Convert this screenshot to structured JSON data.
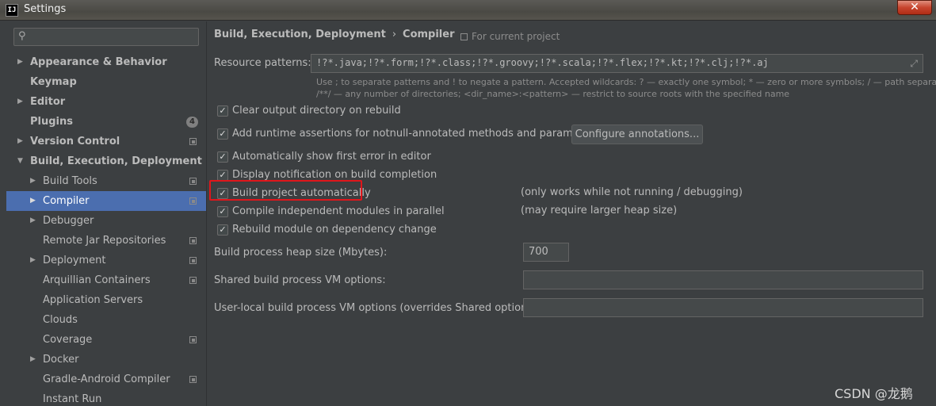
{
  "window": {
    "title": "Settings",
    "app_icon_text": "IJ",
    "close_symbol": "✕"
  },
  "sidebar": {
    "search_icon": "search-icon",
    "items": [
      {
        "label": "Appearance & Behavior",
        "arrow": "▶",
        "bold": true
      },
      {
        "label": "Keymap",
        "arrow": "",
        "bold": true
      },
      {
        "label": "Editor",
        "arrow": "▶",
        "bold": true
      },
      {
        "label": "Plugins",
        "arrow": "",
        "bold": true,
        "badge": "4"
      },
      {
        "label": "Version Control",
        "arrow": "▶",
        "bold": true
      },
      {
        "label": "Build, Execution, Deployment",
        "arrow": "▼",
        "bold": true
      },
      {
        "label": "Build Tools",
        "arrow": "▶",
        "bold": false
      },
      {
        "label": "Compiler",
        "arrow": "▶",
        "bold": false,
        "selected": true
      },
      {
        "label": "Debugger",
        "arrow": "▶",
        "bold": false
      },
      {
        "label": "Remote Jar Repositories",
        "arrow": "",
        "bold": false
      },
      {
        "label": "Deployment",
        "arrow": "▶",
        "bold": false
      },
      {
        "label": "Arquillian Containers",
        "arrow": "",
        "bold": false
      },
      {
        "label": "Application Servers",
        "arrow": "",
        "bold": false
      },
      {
        "label": "Clouds",
        "arrow": "",
        "bold": false
      },
      {
        "label": "Coverage",
        "arrow": "",
        "bold": false
      },
      {
        "label": "Docker",
        "arrow": "▶",
        "bold": false
      },
      {
        "label": "Gradle-Android Compiler",
        "arrow": "",
        "bold": false
      },
      {
        "label": "Instant Run",
        "arrow": "",
        "bold": false
      }
    ]
  },
  "breadcrumb": {
    "parent": "Build, Execution, Deployment",
    "separator": "›",
    "current": "Compiler"
  },
  "scope_label": "For current project",
  "resource_patterns": {
    "label": "Resource patterns:",
    "value": "!?*.java;!?*.form;!?*.class;!?*.groovy;!?*.scala;!?*.flex;!?*.kt;!?*.clj;!?*.aj",
    "hint_line1": "Use ; to separate patterns and ! to negate a pattern. Accepted wildcards: ? — exactly one symbol; * — zero or more symbols; / — path separator;",
    "hint_line2": "/**/ — any number of directories;  <dir_name>:<pattern> — restrict to source roots with the specified name"
  },
  "options": {
    "clear_output": {
      "label": "Clear output directory on rebuild",
      "checked": "✓"
    },
    "runtime_assertions": {
      "label": "Add runtime assertions for notnull-annotated methods and parameters",
      "checked": "✓"
    },
    "show_first_error": {
      "label": "Automatically show first error in editor",
      "checked": "✓"
    },
    "display_notification": {
      "label": "Display notification on build completion",
      "checked": "✓"
    },
    "build_automatically": {
      "label": "Build project automatically",
      "checked": "✓",
      "note": "(only works while not running / debugging)"
    },
    "compile_parallel": {
      "label": "Compile independent modules in parallel",
      "checked": "✓",
      "note": "(may require larger heap size)"
    },
    "rebuild_module": {
      "label": "Rebuild module on dependency change",
      "checked": "✓"
    }
  },
  "configure_button": "Configure annotations...",
  "heap_size": {
    "label": "Build process heap size (Mbytes):",
    "value": "700"
  },
  "shared_vm": {
    "label": "Shared build process VM options:",
    "value": ""
  },
  "user_local_vm": {
    "label": "User-local build process VM options (overrides Shared options):",
    "value": ""
  },
  "watermark": "CSDN @龙鹅"
}
